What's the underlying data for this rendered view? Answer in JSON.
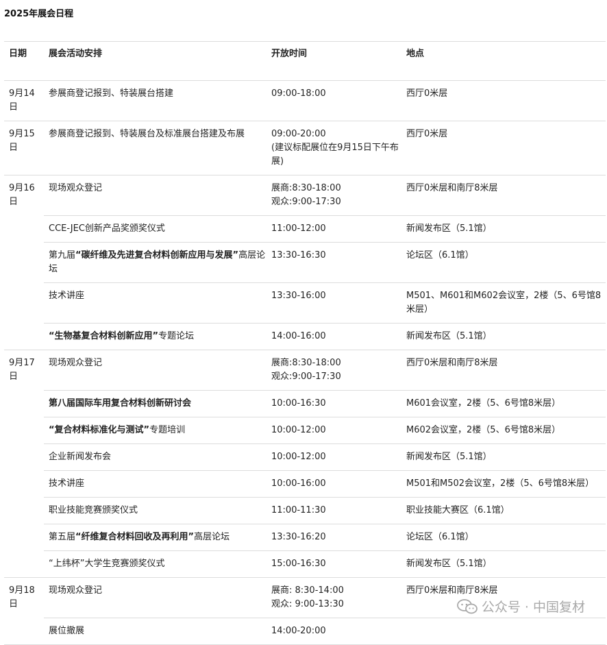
{
  "title": "2025年展会日程",
  "table": {
    "headers": {
      "date": "日期",
      "activity": "展会活动安排",
      "time": "开放时间",
      "location": "地点"
    },
    "groups": [
      {
        "date": "9月14日",
        "rows": [
          {
            "activity": [
              "参展商登记报到、特装展台搭建"
            ],
            "time": [
              "09:00-18:00"
            ],
            "location": "西厅0米层"
          }
        ]
      },
      {
        "date": "9月15日",
        "rows": [
          {
            "activity": [
              "参展商登记报到、特装展台及标准展台搭建及布展"
            ],
            "time": [
              "09:00-20:00",
              "(建议标配展位在9月15日下午布展)"
            ],
            "location": "西厅0米层"
          }
        ]
      },
      {
        "date": "9月16日",
        "rows": [
          {
            "activity": [
              "现场观众登记"
            ],
            "time": [
              "展商:8:30-18:00",
              "观众:9:00-17:30"
            ],
            "location": "西厅0米层和南厅8米层"
          },
          {
            "activity": [
              "CCE-JEC创新产品奖颁奖仪式"
            ],
            "time": [
              "11:00-12:00"
            ],
            "location": "新闻发布区（5.1馆）"
          },
          {
            "activity": [
              "第九届",
              "“碳纤维及先进复合材料创新应用与发展”",
              "高层论坛"
            ],
            "time": [
              "13:30-16:30"
            ],
            "location": "论坛区（6.1馆）"
          },
          {
            "activity": [
              "技术讲座"
            ],
            "time": [
              "13:30-16:00"
            ],
            "location": "M501、M601和M602会议室，2楼（5、6号馆8米层）"
          },
          {
            "activity": [
              "",
              "“生物基复合材料创新应用”",
              "专题论坛"
            ],
            "time": [
              "14:00-16:00"
            ],
            "location": "新闻发布区（5.1馆）"
          }
        ]
      },
      {
        "date": "9月17日",
        "rows": [
          {
            "activity": [
              "现场观众登记"
            ],
            "time": [
              "展商:8:30-18:00",
              "观众:9:00-17:30"
            ],
            "location": "西厅0米层和南厅8米层"
          },
          {
            "activity": [
              "",
              "第八届国际车用复合材料创新研讨会",
              ""
            ],
            "time": [
              "10:00-16:30"
            ],
            "location": "M601会议室，2楼（5、6号馆8米层）"
          },
          {
            "activity": [
              "",
              "“复合材料标准化与测试”",
              "专题培训"
            ],
            "time": [
              "10:00-12:00"
            ],
            "location": "M602会议室，2楼（5、6号馆8米层）"
          },
          {
            "activity": [
              "企业新闻发布会"
            ],
            "time": [
              "10:00-12:00"
            ],
            "location": "新闻发布区（5.1馆）"
          },
          {
            "activity": [
              "技术讲座"
            ],
            "time": [
              "10:00-16:00"
            ],
            "location": "M501和M502会议室，2楼（5、6号馆8米层）"
          },
          {
            "activity": [
              "职业技能竞赛颁奖仪式"
            ],
            "time": [
              "11:00-11:30"
            ],
            "location": "职业技能大赛区（6.1馆）"
          },
          {
            "activity": [
              "第五届",
              "“纤维复合材料回收及再利用”",
              "高层论坛"
            ],
            "time": [
              "13:30-16:20"
            ],
            "location": "论坛区（6.1馆）"
          },
          {
            "activity": [
              "“上纬杯”大学生竞赛颁奖仪式"
            ],
            "time": [
              "15:00-16:30"
            ],
            "location": "新闻发布区（5.1馆）"
          }
        ]
      },
      {
        "date": "9月18日",
        "rows": [
          {
            "activity": [
              "现场观众登记"
            ],
            "time": [
              "展商: 8:30-14:00",
              "观众: 9:00-13:30"
            ],
            "location": "西厅0米层和南厅8米层"
          },
          {
            "activity": [
              "展位撤展"
            ],
            "time": [
              "14:00-20:00"
            ],
            "location": ""
          }
        ]
      }
    ]
  },
  "watermark": {
    "icon": "wechat-icon",
    "text": "公众号 · 中国复材"
  }
}
